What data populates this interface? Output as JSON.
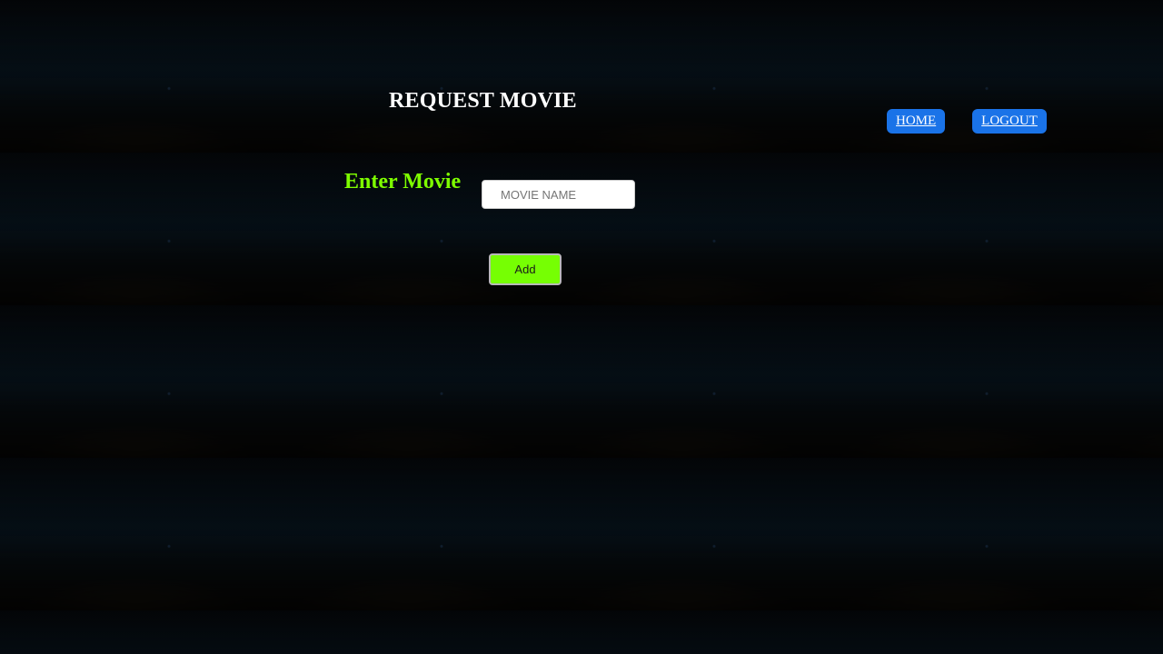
{
  "header": {
    "title": "REQUEST MOVIE"
  },
  "nav": {
    "home_label": "HOME",
    "logout_label": "LOGOUT"
  },
  "form": {
    "movie_label": "Enter Movie",
    "movie_input": {
      "value": "",
      "placeholder": "MOVIE NAME"
    },
    "add_label": "Add"
  },
  "colors": {
    "label_accent": "#7fff00",
    "nav_button_bg": "#1a73e8",
    "add_button_bg": "#76ff03"
  }
}
